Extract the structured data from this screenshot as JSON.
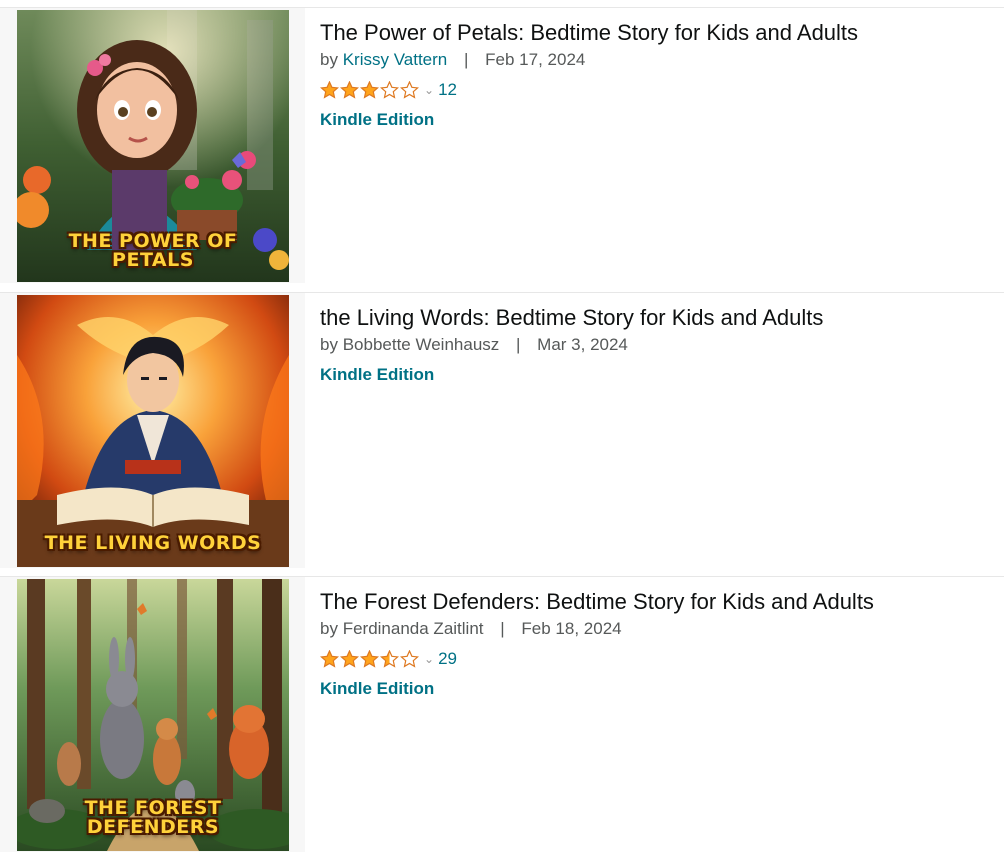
{
  "accent": "#007185",
  "star_color": "#ffa41c",
  "results": [
    {
      "title": "The Power of Petals: Bedtime Story for Kids and Adults",
      "by_prefix": "by",
      "author": "Krissy Vattern",
      "date": "Feb 17, 2024",
      "rating": 3.0,
      "rating_count": "12",
      "edition": "Kindle Edition",
      "cover_text": "THE POWER OF PETALS",
      "cover_icon": "girl-with-flowers-cover"
    },
    {
      "title": "the Living Words: Bedtime Story for Kids and Adults",
      "by_prefix": "by",
      "author": "Bobbette Weinhausz",
      "date": "Mar 3, 2024",
      "edition": "Kindle Edition",
      "cover_text": "THE LIVING WORDS",
      "cover_icon": "boy-reading-fire-cover"
    },
    {
      "title": "The Forest Defenders: Bedtime Story for Kids and Adults",
      "by_prefix": "by",
      "author": "Ferdinanda Zaitlint",
      "date": "Feb 18, 2024",
      "rating": 3.5,
      "rating_count": "29",
      "edition": "Kindle Edition",
      "cover_text": "THE FOREST DEFENDERS",
      "cover_icon": "forest-animals-cover"
    }
  ]
}
